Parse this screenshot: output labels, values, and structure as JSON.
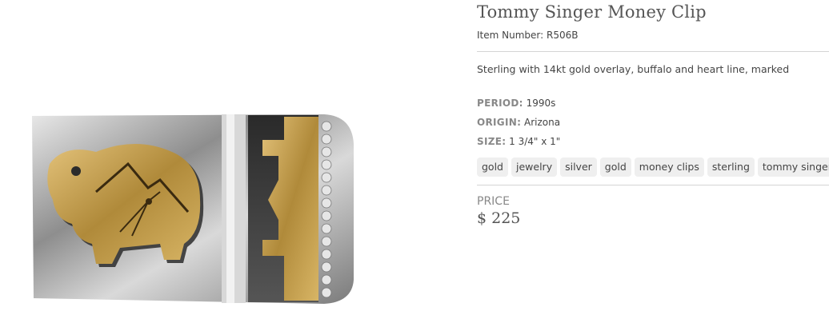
{
  "product": {
    "title": "Tommy Singer Money Clip",
    "item_number": "Item Number: R506B",
    "description": "Sterling with 14kt gold overlay, buffalo and heart line, marked",
    "image_alt": "Tommy Singer sterling silver money clip with gold buffalo overlay"
  },
  "specs": {
    "period_label": "PERIOD:",
    "period_value": " 1990s",
    "origin_label": "ORIGIN:",
    "origin_value": " Arizona",
    "size_label": "SIZE:",
    "size_value": " 1 3/4\" x 1\""
  },
  "tags": [
    "gold",
    "jewelry",
    "silver",
    "gold",
    "money clips",
    "sterling",
    "tommy singer"
  ],
  "pricing": {
    "label": "PRICE",
    "value": "$ 225"
  },
  "colors": {
    "silver": "#bfbfbf",
    "gold": "#c9a24a",
    "text": "#444444",
    "muted": "#888888"
  }
}
